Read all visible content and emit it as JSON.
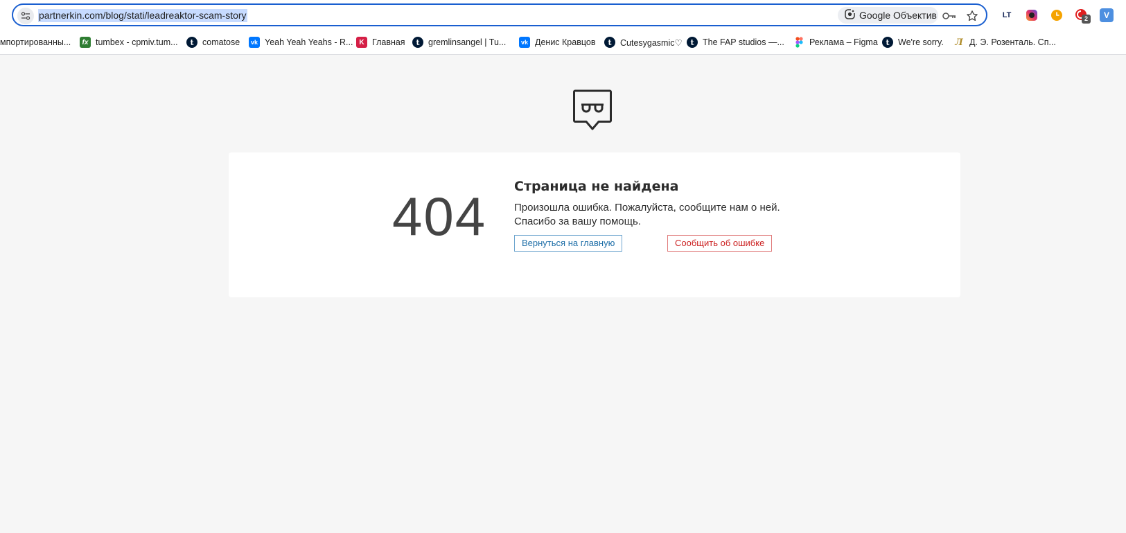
{
  "browser": {
    "url": "partnerkin.com/blog/stati/leadreaktor-scam-story",
    "lens_label": "Google Объектив",
    "extensions": [
      {
        "name": "lt-extension",
        "label": "LT"
      },
      {
        "name": "instagram-extension",
        "label": ""
      },
      {
        "name": "timer-extension",
        "label": ""
      },
      {
        "name": "red-extension",
        "label": "",
        "badge": "2"
      },
      {
        "name": "v-extension",
        "label": "V"
      }
    ]
  },
  "bookmarks": [
    {
      "label": "мпортированны...",
      "icon": "none"
    },
    {
      "label": "tumbex - cpmiv.tum...",
      "icon": "fx"
    },
    {
      "label": "comatose",
      "icon": "tumblr"
    },
    {
      "label": "Yeah Yeah Yeahs - R...",
      "icon": "vk"
    },
    {
      "label": "Главная",
      "icon": "kinopoisk"
    },
    {
      "label": "gremlinsangel | Tu...",
      "icon": "tumblr"
    },
    {
      "label": "Денис Кравцов",
      "icon": "vk"
    },
    {
      "label": "Cutesygasmic♡",
      "icon": "tumblr"
    },
    {
      "label": "The FAP studios —...",
      "icon": "tumblr"
    },
    {
      "label": "Реклама – Figma",
      "icon": "figma"
    },
    {
      "label": "We're sorry.",
      "icon": "tumblr"
    },
    {
      "label": "Д. Э. Розенталь. Сп...",
      "icon": "rozental"
    }
  ],
  "error": {
    "code": "404",
    "title": "Страница не найдена",
    "line1": "Произошла ошибка. Пожалуйста, сообщите нам о ней.",
    "line2": "Спасибо за вашу помощь.",
    "home_button": "Вернуться на главную",
    "report_button": "Сообщить об ошибке"
  },
  "colors": {
    "page_bg": "#f6f6f6",
    "card_bg": "#ffffff",
    "home_button": "#1f6fa8",
    "report_button": "#cc2222",
    "omnibox_border": "#1a5fd0"
  }
}
